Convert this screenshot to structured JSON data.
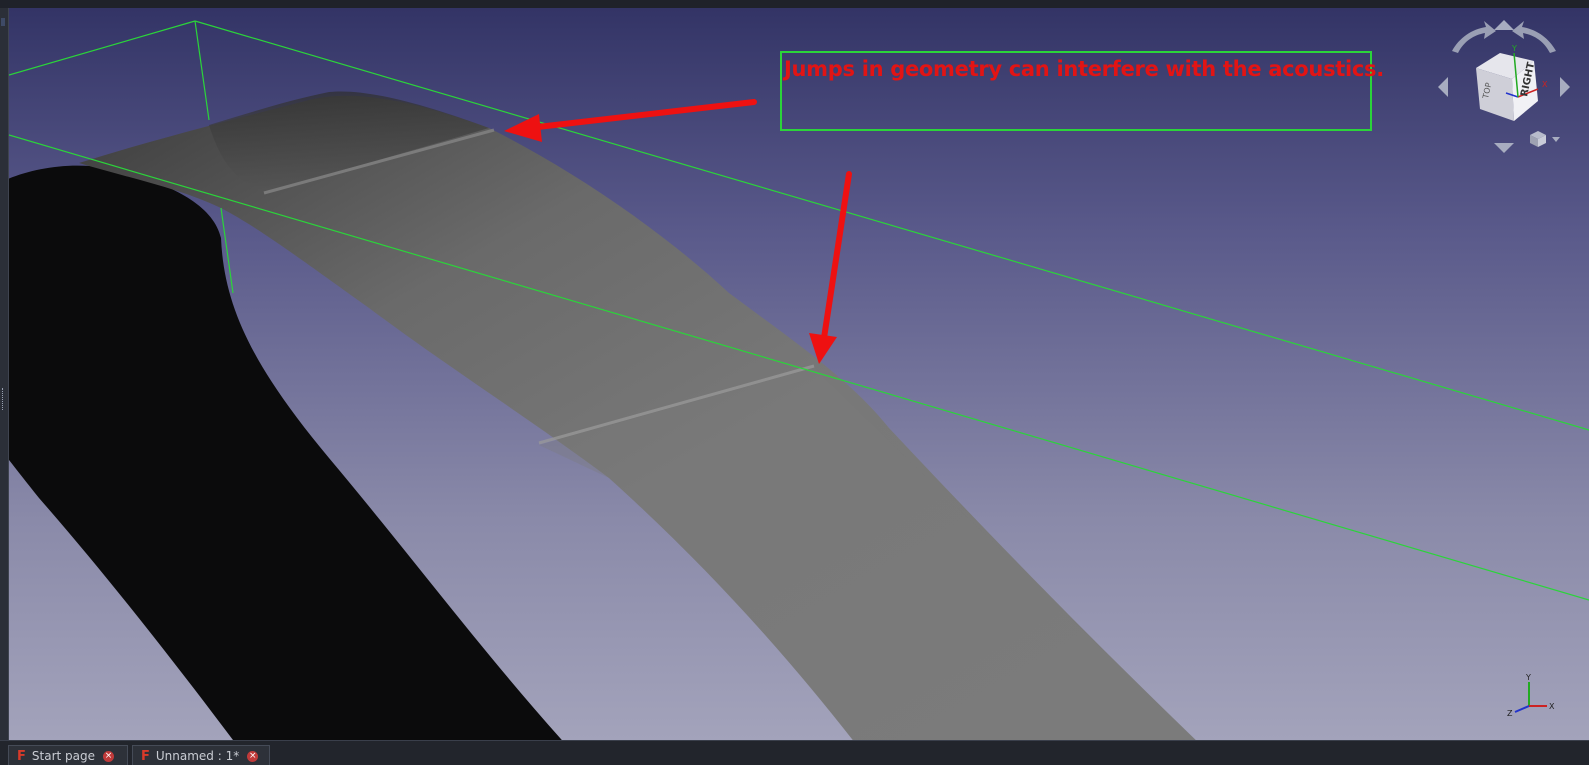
{
  "annotation": {
    "text": "Jumps in geometry can interfere with the acoustics."
  },
  "navcube": {
    "face_right": "RIGHT",
    "face_left": "TOP",
    "axis_x": "X",
    "axis_y": "Y",
    "axis_z": "Z"
  },
  "mini_axis": {
    "x": "X",
    "y": "Y",
    "z": "Z"
  },
  "tabs": [
    {
      "label": "Start page"
    },
    {
      "label": "Unnamed : 1*"
    }
  ],
  "colors": {
    "annotation_text": "#e21414",
    "annotation_box": "#2bd43a",
    "bounding_box": "#2bd43a",
    "arrow": "#ee1111",
    "viewport_top": "#333466",
    "viewport_bottom": "#a3a3bb"
  },
  "icons": [
    "freecad-logo-icon",
    "close-icon",
    "rotate-left-icon",
    "rotate-right-icon",
    "arrow-up-icon",
    "arrow-down-icon",
    "arrow-left-icon",
    "arrow-right-icon",
    "view-menu-icon"
  ]
}
